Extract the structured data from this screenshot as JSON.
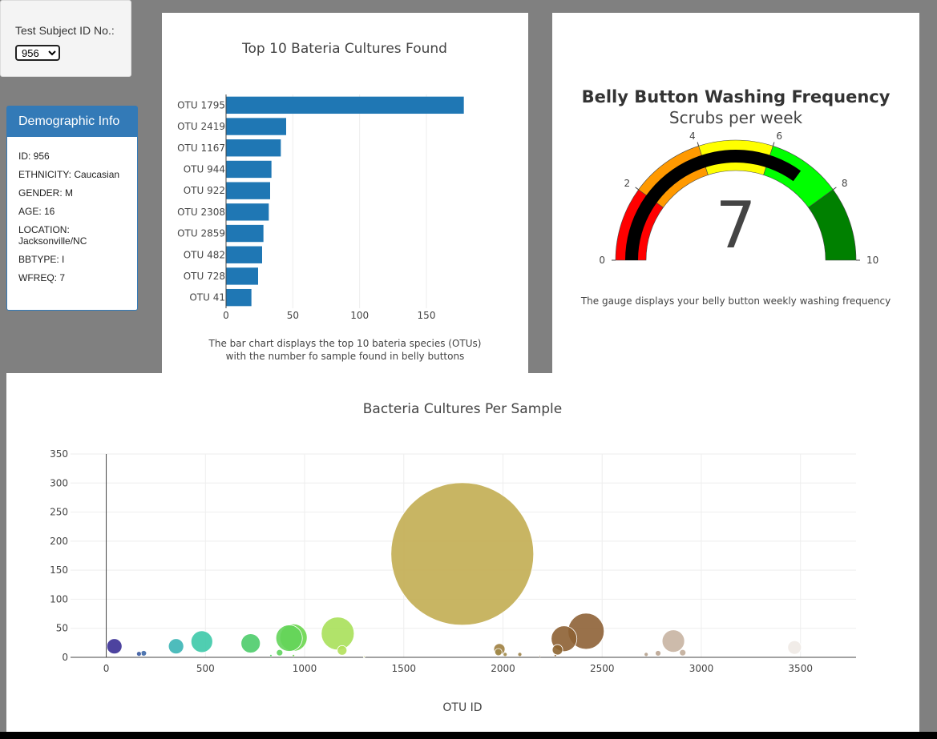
{
  "selector": {
    "label": "Test Subject ID No.:",
    "selected": "956"
  },
  "demographics": {
    "heading": "Demographic Info",
    "lines": [
      "ID: 956",
      "ETHNICITY: Caucasian",
      "GENDER: M",
      "AGE: 16",
      "LOCATION: Jacksonville/NC",
      "BBTYPE: I",
      "WFREQ: 7"
    ]
  },
  "bar_caption": {
    "line1": "The bar chart displays the top 10 bateria species (OTUs)",
    "line2": "with the number fo sample found in belly buttons"
  },
  "gauge_caption": "The gauge displays your belly button weekly washing frequency",
  "colors": {
    "bar": "#1f77b4",
    "gauge_bands": [
      "#ff0000",
      "#ff9900",
      "#ffff00",
      "#00ff00",
      "#008000"
    ],
    "gauge_needle": "#000000"
  },
  "chart_data": [
    {
      "type": "bar",
      "orientation": "horizontal",
      "title": "Top 10 Bateria Cultures Found",
      "categories": [
        "OTU 1795",
        "OTU 2419",
        "OTU 1167",
        "OTU 944",
        "OTU 922",
        "OTU 2308",
        "OTU 2859",
        "OTU 482",
        "OTU 728",
        "OTU 41"
      ],
      "values": [
        178,
        45,
        41,
        34,
        33,
        32,
        28,
        27,
        24,
        19
      ],
      "xticks": [
        0,
        50,
        100,
        150
      ],
      "xlim": [
        0,
        180
      ],
      "grid": true
    },
    {
      "type": "gauge",
      "title": "Belly Button Washing Frequency",
      "subtitle": "Scrubs per week",
      "value": 7,
      "range": [
        0,
        10
      ],
      "ticks": [
        0,
        2,
        4,
        6,
        8,
        10
      ],
      "bands": [
        [
          0,
          2
        ],
        [
          2,
          4
        ],
        [
          4,
          6
        ],
        [
          6,
          8
        ],
        [
          8,
          10
        ]
      ]
    },
    {
      "type": "scatter",
      "style": "bubble",
      "title": "Bacteria Cultures Per Sample",
      "xlabel": "OTU ID",
      "ylabel": "",
      "xlim": [
        -180,
        3780
      ],
      "ylim": [
        0,
        350
      ],
      "xticks": [
        0,
        500,
        1000,
        1500,
        2000,
        2500,
        3000,
        3500
      ],
      "yticks": [
        0,
        50,
        100,
        150,
        200,
        250,
        300,
        350
      ],
      "grid": true,
      "points": [
        {
          "x": 41,
          "y": 19,
          "color": "#3a2f95"
        },
        {
          "x": 165,
          "y": 6,
          "color": "#3a5aa0"
        },
        {
          "x": 189,
          "y": 7,
          "color": "#3d68a8"
        },
        {
          "x": 352,
          "y": 19,
          "color": "#3bb5b5"
        },
        {
          "x": 482,
          "y": 27,
          "color": "#3dc9a8"
        },
        {
          "x": 728,
          "y": 24,
          "color": "#4ccc6a"
        },
        {
          "x": 830,
          "y": 3,
          "color": "#5ad06a"
        },
        {
          "x": 874,
          "y": 8,
          "color": "#5fd45e"
        },
        {
          "x": 922,
          "y": 33,
          "color": "#64d45a"
        },
        {
          "x": 944,
          "y": 34,
          "color": "#6ad64e"
        },
        {
          "x": 944,
          "y": 3,
          "color": "#6ad64e"
        },
        {
          "x": 1167,
          "y": 41,
          "color": "#a8e05a"
        },
        {
          "x": 1189,
          "y": 12,
          "color": "#b2e05a"
        },
        {
          "x": 1300,
          "y": 1,
          "color": "#c8d46a"
        },
        {
          "x": 1795,
          "y": 178,
          "color": "#c2ad52"
        },
        {
          "x": 1977,
          "y": 9,
          "color": "#a08848"
        },
        {
          "x": 1982,
          "y": 14,
          "color": "#9e8040"
        },
        {
          "x": 2011,
          "y": 5,
          "color": "#a08848"
        },
        {
          "x": 2085,
          "y": 5,
          "color": "#9c8248"
        },
        {
          "x": 2186,
          "y": 2,
          "color": "#9a7c48"
        },
        {
          "x": 2264,
          "y": 3,
          "color": "#926e40"
        },
        {
          "x": 2275,
          "y": 13,
          "color": "#8d6430"
        },
        {
          "x": 2308,
          "y": 32,
          "color": "#8d6033"
        },
        {
          "x": 2419,
          "y": 45,
          "color": "#8e6236"
        },
        {
          "x": 2722,
          "y": 5,
          "color": "#b4a08c"
        },
        {
          "x": 2782,
          "y": 7,
          "color": "#bba592"
        },
        {
          "x": 2859,
          "y": 28,
          "color": "#c8b4a2"
        },
        {
          "x": 2906,
          "y": 8,
          "color": "#c2ad9a"
        },
        {
          "x": 3470,
          "y": 17,
          "color": "#efeae6"
        }
      ]
    }
  ]
}
